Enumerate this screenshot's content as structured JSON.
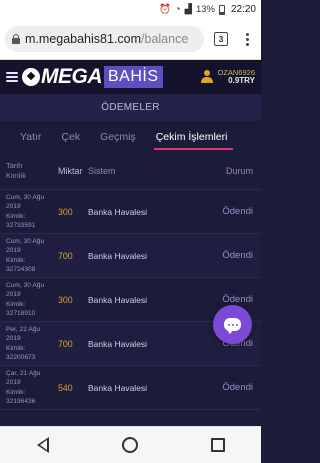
{
  "status_bar": {
    "battery": "13%",
    "time": "22:20"
  },
  "browser": {
    "url_main": "m.megabahis81.com",
    "url_rest": "/balance",
    "tab_count": "3"
  },
  "site": {
    "logo_mega": "MEGA",
    "logo_bahis": "BAHİS",
    "username": "OZAN6926",
    "balance": "0.9TRY"
  },
  "page": {
    "title": "ÖDEMELER",
    "tabs": [
      {
        "label": "Yatır"
      },
      {
        "label": "Çek"
      },
      {
        "label": "Geçmiş"
      },
      {
        "label": "Çekim İşlemleri"
      }
    ]
  },
  "table": {
    "headers": {
      "date": "Tarih",
      "id": "Kimlik",
      "amount": "Miktar",
      "system": "Sistem",
      "status": "Durum"
    },
    "rows": [
      {
        "date_line1": "Cum, 30 Ağu",
        "date_line2": "2019",
        "id_label": "Kimlik:",
        "id": "32733591",
        "amount": "300",
        "system": "Banka Havalesi",
        "status": "Ödendi"
      },
      {
        "date_line1": "Cum, 30 Ağu",
        "date_line2": "2019",
        "id_label": "Kimlik:",
        "id": "32724308",
        "amount": "700",
        "system": "Banka Havalesi",
        "status": "Ödendi"
      },
      {
        "date_line1": "Cum, 30 Ağu",
        "date_line2": "2019",
        "id_label": "Kimlik:",
        "id": "32718910",
        "amount": "300",
        "system": "Banka Havalesi",
        "status": "Ödendi"
      },
      {
        "date_line1": "Per, 22 Ağu",
        "date_line2": "2019",
        "id_label": "Kimlik:",
        "id": "32200673",
        "amount": "700",
        "system": "Banka Havalesi",
        "status": "Ödendi"
      },
      {
        "date_line1": "Çar, 21 Ağu",
        "date_line2": "2019",
        "id_label": "Kimlik:",
        "id": "32196436",
        "amount": "540",
        "system": "Banka Havalesi",
        "status": "Ödendi"
      }
    ]
  },
  "icons": {
    "chat": "chat-bubble-icon",
    "lock": "lock-icon",
    "user": "user-icon"
  }
}
